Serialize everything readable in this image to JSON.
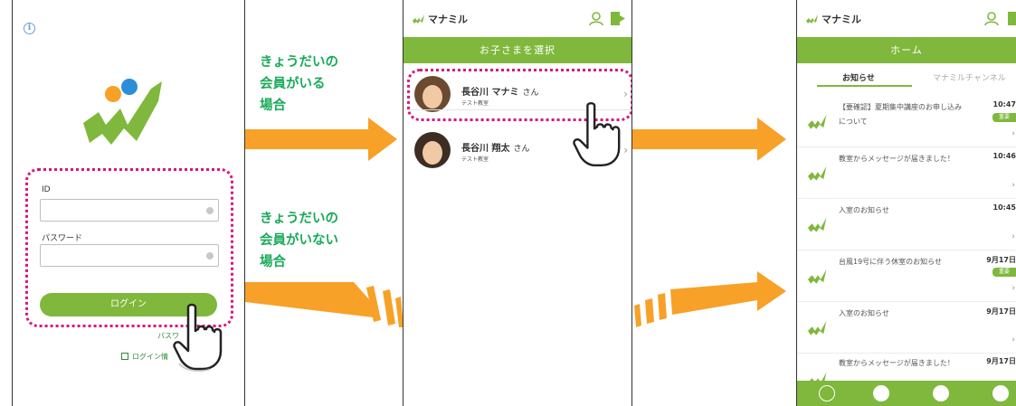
{
  "login": {
    "id_label": "ID",
    "password_label": "パスワード",
    "login_button": "ログイン",
    "forgot_text": "パスワ",
    "remember_text": "ログイン情"
  },
  "captions": {
    "with_sibling": "きょうだいの\n会員がいる\n場合",
    "without_sibling": "きょうだいの\n会員がいない\n場合"
  },
  "app": {
    "name": "マナミル",
    "select_title": "お子さまを選択",
    "home_title": "ホーム"
  },
  "children": [
    {
      "name": "長谷川 マナミ",
      "honorific": "さん",
      "school": "テスト教室"
    },
    {
      "name": "長谷川 翔太",
      "honorific": "さん",
      "school": "テスト教室"
    }
  ],
  "home": {
    "tabs": [
      "お知らせ",
      "マナミルチャンネル"
    ],
    "notices": [
      {
        "title": "【要確認】夏期集中講座のお申し込みについて",
        "time": "10:47",
        "badge": "重要"
      },
      {
        "title": "教室からメッセージが届きました！",
        "time": "10:46",
        "badge": ""
      },
      {
        "title": "入室のお知らせ",
        "time": "10:45",
        "badge": ""
      },
      {
        "title": "台風19号に伴う休室のお知らせ",
        "time": "9月17日",
        "badge": "重要"
      },
      {
        "title": "入室のお知らせ",
        "time": "9月17日",
        "badge": ""
      },
      {
        "title": "教室からメッセージが届きました！",
        "time": "9月17日",
        "badge": ""
      }
    ]
  },
  "colors": {
    "brand_green": "#7fb83c",
    "caption_green": "#1aaa5a",
    "arrow_orange": "#f7a128",
    "highlight_magenta": "#d6177d"
  }
}
